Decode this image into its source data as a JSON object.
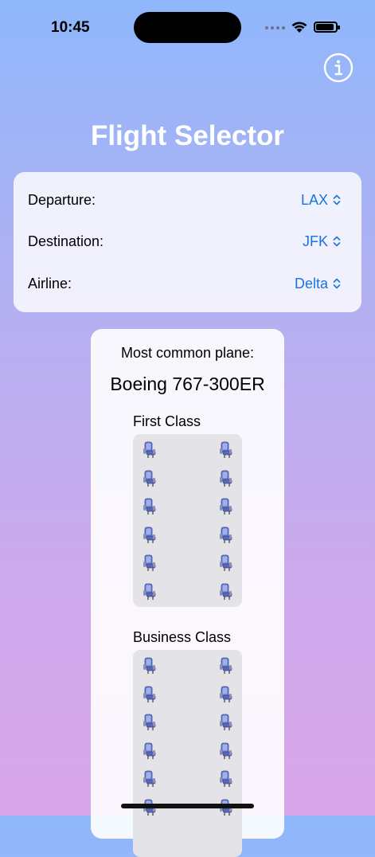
{
  "status": {
    "time": "10:45"
  },
  "title": "Flight Selector",
  "form": {
    "rows": [
      {
        "label": "Departure:",
        "value": "LAX"
      },
      {
        "label": "Destination:",
        "value": "JFK"
      },
      {
        "label": "Airline:",
        "value": "Delta"
      }
    ]
  },
  "plane": {
    "common_label": "Most common plane:",
    "name": "Boeing 767-300ER",
    "classes": [
      {
        "label": "First Class",
        "rows": 6,
        "seats_per_row": 2
      },
      {
        "label": "Business Class",
        "rows": 6,
        "seats_per_row": 2
      }
    ]
  },
  "icons": [
    "info-icon",
    "wifi-icon",
    "battery-icon",
    "seat-icon",
    "chevron-up-down-icon"
  ],
  "colors": {
    "accent": "#1a73e0",
    "title": "#ffffff",
    "gradient_top": "#8fb7fb",
    "gradient_bottom": "#d8a6e8"
  }
}
